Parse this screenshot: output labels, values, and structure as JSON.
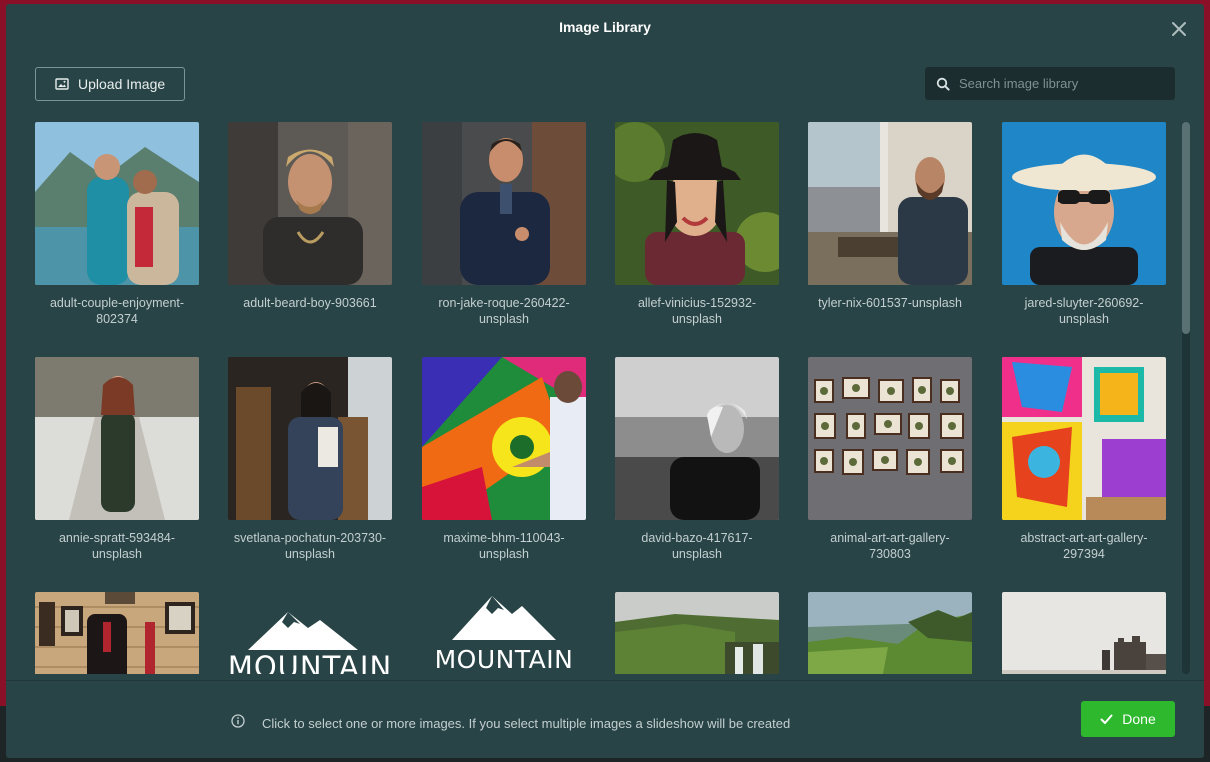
{
  "modal": {
    "title": "Image Library"
  },
  "toolbar": {
    "upload_label": "Upload Image"
  },
  "search": {
    "placeholder": "Search image library"
  },
  "images": [
    {
      "caption": "adult-couple-enjoyment-802374"
    },
    {
      "caption": "adult-beard-boy-903661"
    },
    {
      "caption": "ron-jake-roque-260422-unsplash"
    },
    {
      "caption": "allef-vinicius-152932-unsplash"
    },
    {
      "caption": "tyler-nix-601537-unsplash"
    },
    {
      "caption": "jared-sluyter-260692-unsplash"
    },
    {
      "caption": "annie-spratt-593484-unsplash"
    },
    {
      "caption": "svetlana-pochatun-203730-unsplash"
    },
    {
      "caption": "maxime-bhm-110043-unsplash"
    },
    {
      "caption": "david-bazo-417617-unsplash"
    },
    {
      "caption": "animal-art-art-gallery-730803"
    },
    {
      "caption": "abstract-art-art-gallery-297394"
    },
    {
      "caption": ""
    },
    {
      "caption": "",
      "logo_text": "MOUNTAIN"
    },
    {
      "caption": "",
      "logo_text": "MOUNTAIN"
    },
    {
      "caption": ""
    },
    {
      "caption": ""
    },
    {
      "caption": ""
    }
  ],
  "footer": {
    "info_text": "Click to select one or more images. If you select multiple images a slideshow will be created",
    "done_label": "Done"
  },
  "colors": {
    "modal_bg": "#294446",
    "backdrop": "#8a1028",
    "done_green": "#2db82d"
  },
  "icons": [
    "close-icon",
    "image-icon",
    "search-icon",
    "info-icon",
    "checkmark-icon"
  ]
}
